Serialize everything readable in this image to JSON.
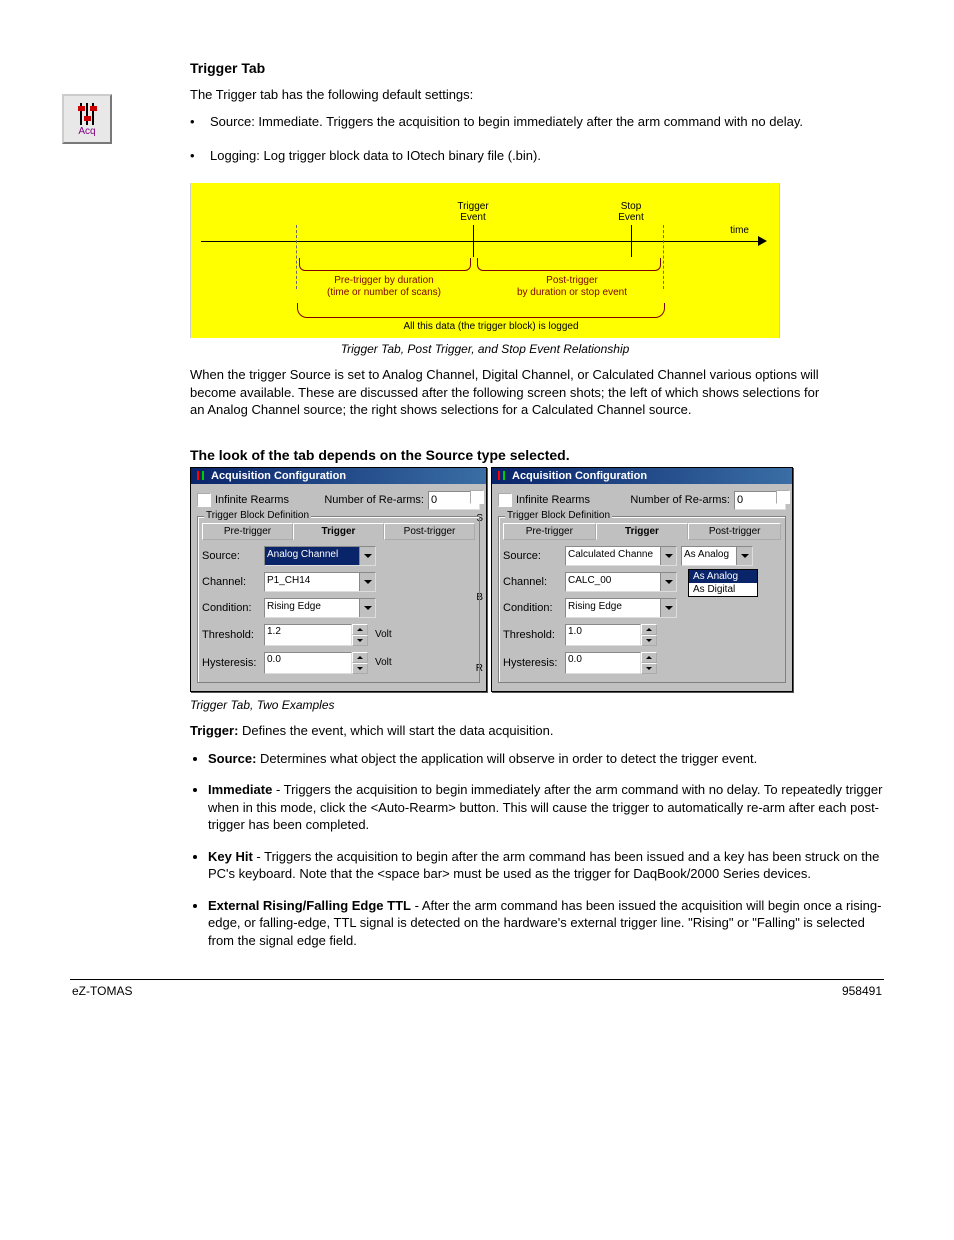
{
  "section": {
    "title": "Trigger Tab",
    "intro": "The Trigger tab has the following default settings:",
    "intro_bullets": [
      "Source: Immediate. Triggers the acquisition to begin immediately after the arm command with no delay.",
      "Logging: Log trigger block data to IOtech binary file (.bin)."
    ]
  },
  "diagram": {
    "trigger_event": "Trigger\nEvent",
    "stop_event": "Stop\nEvent",
    "time_label": "time",
    "pre_label": "Pre-trigger by duration\n(time or number of scans)",
    "post_label": "Post-trigger\nby duration or stop event",
    "all_label": "All this data (the trigger block) is logged",
    "caption": "Trigger Tab, Post Trigger, and Stop Event Relationship"
  },
  "para_after_diagram": "When the trigger Source is set to Analog Channel, Digital Channel, or Calculated Channel various options will become available. These are discussed after the following screen shots; the left of which shows selections for an Analog Channel source; the right shows selections for a Calculated Channel source.",
  "subheading": "The look of the tab depends on the Source type selected.",
  "windowA": {
    "title": "Acquisition Configuration",
    "infinite_rearms_label": "Infinite Rearms",
    "num_rearms_label": "Number of Re-arms:",
    "num_rearms_value": "0",
    "fieldset_label": "Trigger Block Definition",
    "tabs": {
      "pre": "Pre-trigger",
      "trig": "Trigger",
      "post": "Post-trigger"
    },
    "source_label": "Source:",
    "source_value": "Analog Channel",
    "channel_label": "Channel:",
    "channel_value": "P1_CH14",
    "condition_label": "Condition:",
    "condition_value": "Rising Edge",
    "threshold_label": "Threshold:",
    "threshold_value": "1.2",
    "hysteresis_label": "Hysteresis:",
    "hysteresis_value": "0.0",
    "unit": "Volt",
    "edge_letters": [
      "S",
      "B",
      "R"
    ]
  },
  "windowB": {
    "title": "Acquisition Configuration",
    "infinite_rearms_label": "Infinite Rearms",
    "num_rearms_label": "Number of Re-arms:",
    "num_rearms_value": "0",
    "fieldset_label": "Trigger Block Definition",
    "tabs": {
      "pre": "Pre-trigger",
      "trig": "Trigger",
      "post": "Post-trigger"
    },
    "source_label": "Source:",
    "source_value": "Calculated Channe",
    "as_label": "As Analog",
    "dropdown_options": [
      "As Analog",
      "As Digital"
    ],
    "channel_label": "Channel:",
    "channel_value": "CALC_00",
    "condition_label": "Condition:",
    "condition_value": "Rising Edge",
    "threshold_label": "Threshold:",
    "threshold_value": "1.0",
    "hysteresis_label": "Hysteresis:",
    "hysteresis_value": "0.0"
  },
  "caption2": "Trigger Tab, Two Examples",
  "trigger_section": {
    "label": "Trigger:",
    "text": "Defines the event, which will start the data acquisition."
  },
  "after_bullets": [
    {
      "label": "Source:",
      "text": "Determines what object the application will observe in order to detect the trigger event."
    },
    {
      "label": "Immediate",
      "text": "- Triggers the acquisition to begin immediately after the arm command with no delay. To repeatedly trigger when in this mode, click the <Auto-Rearm> button. This will cause the trigger to automatically re-arm after each post-trigger has been completed."
    },
    {
      "label": "Key Hit",
      "text": "- Triggers the acquisition to begin after the arm command has been issued and a key has been struck on the PC's keyboard. Note that the <space bar> must be used as the trigger for DaqBook/2000 Series devices."
    },
    {
      "label": "External Rising/Falling Edge TTL",
      "text": "- After the arm command has been issued the acquisition will begin once a rising-edge, or falling-edge, TTL signal is detected on the hardware's external trigger line. \"Rising\" or \"Falling\" is selected from the signal edge field."
    }
  ],
  "footer": {
    "left": "eZ-TOMAS",
    "right": "958491"
  }
}
